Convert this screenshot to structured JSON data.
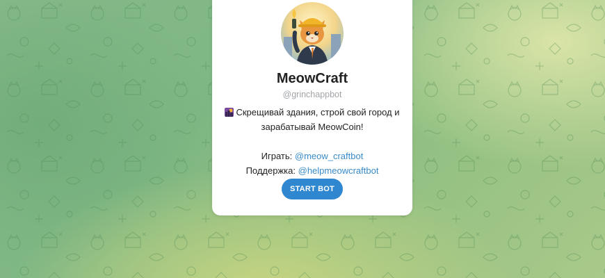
{
  "bot": {
    "name": "MeowCraft",
    "username": "@grinchappbot",
    "avatar_icon": "cat-builder-avatar"
  },
  "description": {
    "emoji_icon": "city-skyline-emoji",
    "line1": "Скрещивай здания, строй свой город и",
    "line2": "зарабатывай MeowCoin!",
    "play_label": "Играть:",
    "play_link": "@meow_craftbot",
    "support_label": "Поддержка:",
    "support_link": "@helpmeowcraftbot"
  },
  "actions": {
    "start_label": "START BOT"
  },
  "colors": {
    "accent": "#2f87cf",
    "link": "#3a8bc9",
    "background": "#86b98a"
  }
}
